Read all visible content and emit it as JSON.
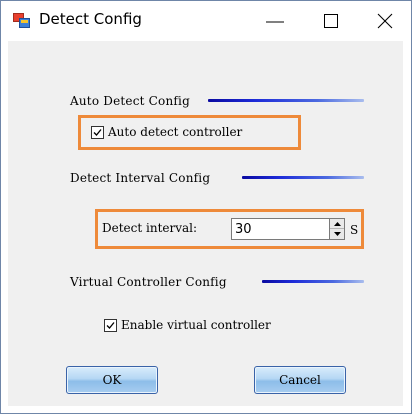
{
  "window": {
    "title": "Detect Config",
    "icon": "app-icon",
    "controls": [
      "minimize-icon",
      "maximize-icon",
      "close-icon"
    ]
  },
  "sections": {
    "auto_detect": {
      "title": "Auto Detect Config",
      "checkbox_label": "Auto detect controller",
      "checked": true
    },
    "detect_interval": {
      "title": "Detect Interval Config",
      "label": "Detect interval:",
      "value": "30",
      "unit": "S"
    },
    "virtual_controller": {
      "title": "Virtual Controller Config",
      "checkbox_label": "Enable virtual controller",
      "checked": true
    }
  },
  "buttons": {
    "ok": "OK",
    "cancel": "Cancel"
  },
  "colors": {
    "highlight": "#ee8a3a",
    "section_line": "#1d2bd8",
    "button_top": "#d9ecfb",
    "button_bottom": "#8dbde9"
  }
}
